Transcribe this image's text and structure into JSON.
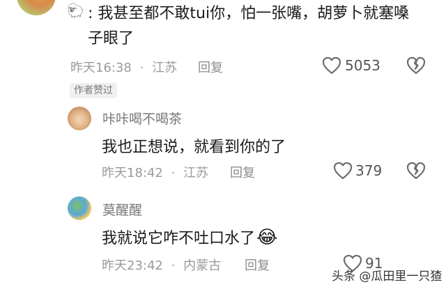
{
  "comment1": {
    "text": "我甚至都不敢tui你，怕一张嘴，胡萝卜就塞嗓子眼了",
    "time": "昨天16:38",
    "location": "江苏",
    "reply_label": "回复",
    "likes": "5053",
    "badge": "作者赞过"
  },
  "comment2": {
    "username": "咔咔喝不喝茶",
    "text": "我也正想说，就看到你的了",
    "time": "昨天18:42",
    "location": "江苏",
    "reply_label": "回复",
    "likes": "379"
  },
  "comment3": {
    "username": "莫醒醒",
    "text": "我就说它咋不吐口水了",
    "emoji": "😂",
    "time": "昨天23:42",
    "location": "内蒙古",
    "reply_label": "回复",
    "likes": "91"
  },
  "meta_separator": "·",
  "watermark": "头条 @瓜田里一只猹",
  "colors": {
    "meta": "#9a9a9a",
    "text": "#1a1a1a",
    "icon": "#8a8a8a"
  }
}
